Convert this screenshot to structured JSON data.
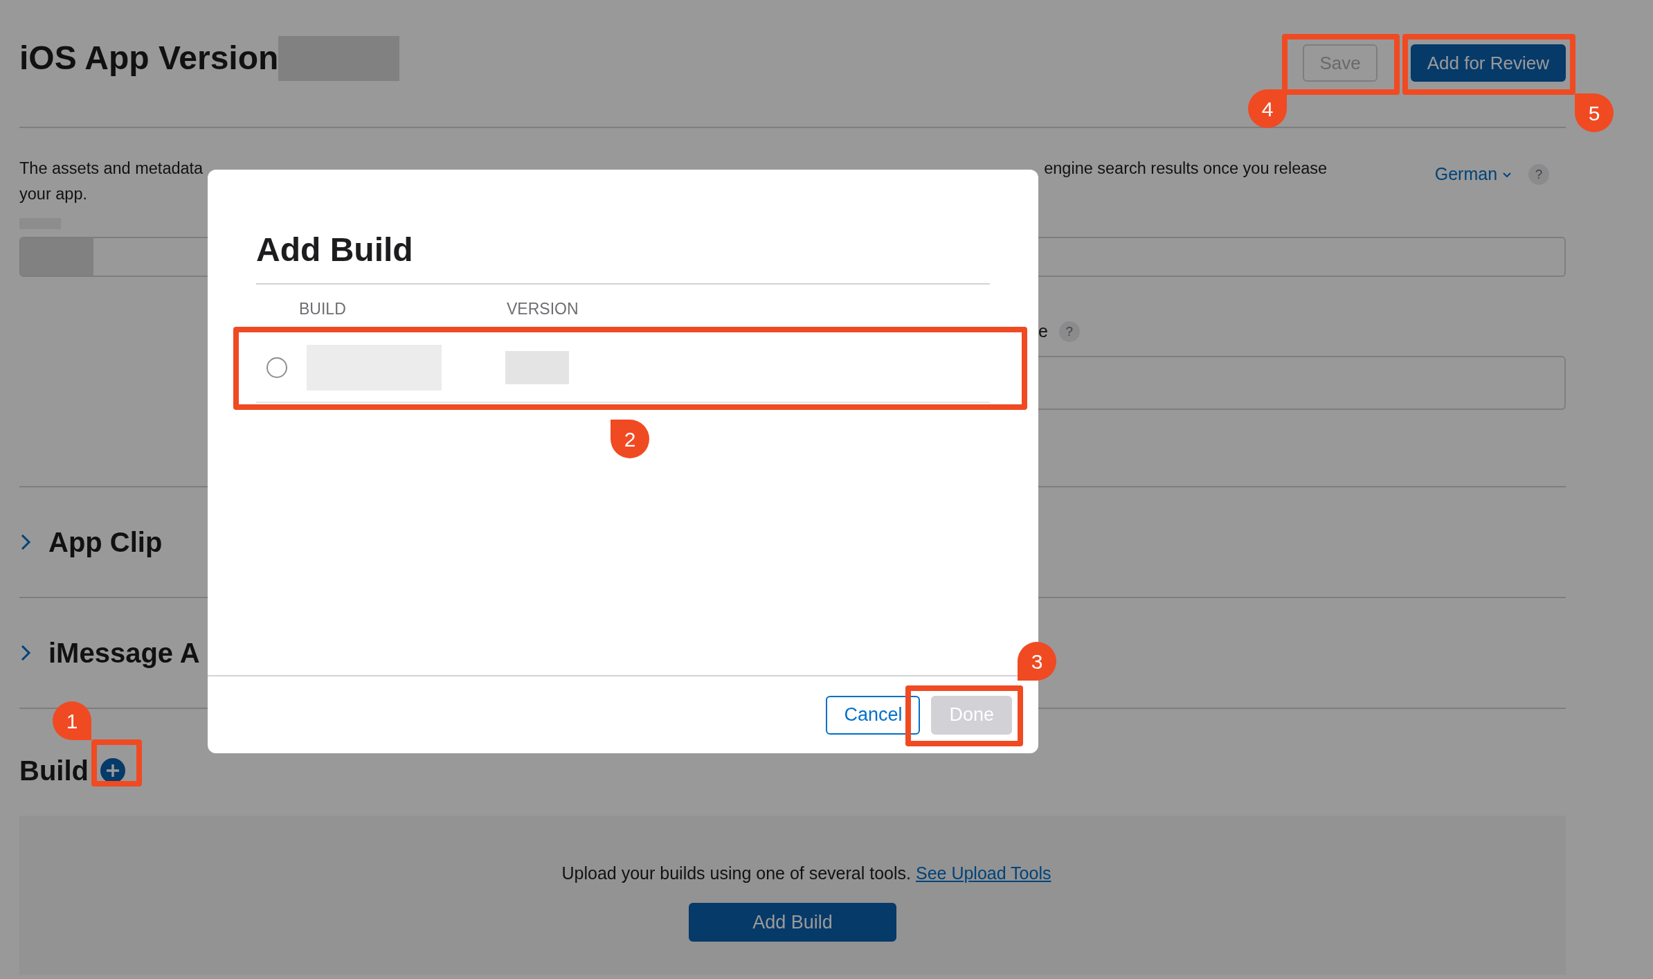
{
  "page": {
    "title": "iOS App Version",
    "actions": [
      {
        "label": "Save",
        "disabled": true
      },
      {
        "label": "Add for Review",
        "disabled": false
      }
    ],
    "description": [
      "The assets and metadata",
      "engine search results once you release",
      "your app."
    ],
    "language": "German",
    "help": "?",
    "field_label": "e",
    "field_help": "?",
    "sections": [
      {
        "title": "App Clip",
        "expanded": false
      },
      {
        "title": "iMessage A",
        "expanded": false
      }
    ],
    "build": {
      "title": "Build",
      "hint": "Upload your builds using one of several tools.",
      "link": "See Upload Tools",
      "button": "Add Build"
    }
  },
  "dialog": {
    "title": "Add Build",
    "columns": [
      "BUILD",
      "VERSION"
    ],
    "rows": [
      {
        "selected": false
      }
    ],
    "buttons": [
      {
        "label": "Cancel",
        "kind": "outline",
        "disabled": false
      },
      {
        "label": "Done",
        "kind": "primary",
        "disabled": true
      }
    ]
  },
  "callouts": [
    "1",
    "2",
    "3",
    "4",
    "5"
  ]
}
